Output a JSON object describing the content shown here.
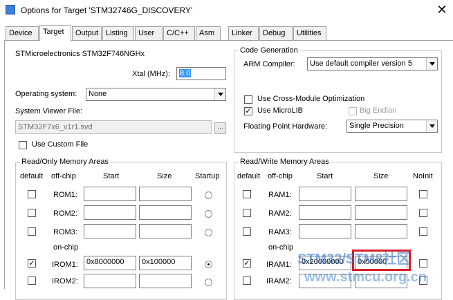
{
  "window": {
    "title": "Options for Target 'STM32746G_DISCOVERY'",
    "close_glyph": "✕"
  },
  "tabs": [
    {
      "label": "Device"
    },
    {
      "label": "Target"
    },
    {
      "label": "Output"
    },
    {
      "label": "Listing"
    },
    {
      "label": "User"
    },
    {
      "label": "C/C++"
    },
    {
      "label": "Asm"
    },
    {
      "label": "Linker"
    },
    {
      "label": "Debug"
    },
    {
      "label": "Utilities"
    }
  ],
  "target": {
    "device_name": "STMicroelectronics STM32F746NGHx",
    "xtal_label": "Xtal (MHz):",
    "xtal_value": "8.0",
    "os_label": "Operating system:",
    "os_value": "None",
    "svf_label": "System Viewer File:",
    "svf_value": "STM32F7x6_v1r1.svd",
    "browse_label": "...",
    "custom_file_label": "Use Custom File"
  },
  "code_generation": {
    "title": "Code Generation",
    "arm_compiler_label": "ARM Compiler:",
    "arm_compiler_value": "Use default compiler version 5",
    "cross_module_label": "Use Cross-Module Optimization",
    "microlib_label": "Use MicroLIB",
    "big_endian_label": "Big Endian",
    "fph_label": "Floating Point Hardware:",
    "fph_value": "Single Precision",
    "check_glyph": "✓"
  },
  "ro_memory": {
    "title": "Read/Only Memory Areas",
    "headers": {
      "default": "default",
      "offchip": "off-chip",
      "start": "Start",
      "size": "Size",
      "startup": "Startup"
    },
    "onchip_label": "on-chip",
    "rows": [
      {
        "name": "ROM1:",
        "start": "",
        "size": ""
      },
      {
        "name": "ROM2:",
        "start": "",
        "size": ""
      },
      {
        "name": "ROM3:",
        "start": "",
        "size": ""
      },
      {
        "name": "IROM1:",
        "start": "0x8000000",
        "size": "0x100000"
      },
      {
        "name": "IROM2:",
        "start": "",
        "size": ""
      }
    ]
  },
  "rw_memory": {
    "title": "Read/Write Memory Areas",
    "headers": {
      "default": "default",
      "offchip": "off-chip",
      "start": "Start",
      "size": "Size",
      "noinit": "NoInit"
    },
    "onchip_label": "on-chip",
    "rows": [
      {
        "name": "RAM1:",
        "start": "",
        "size": ""
      },
      {
        "name": "RAM2:",
        "start": "",
        "size": ""
      },
      {
        "name": "RAM3:",
        "start": "",
        "size": ""
      },
      {
        "name": "IRAM1:",
        "start": "0x20000000",
        "size": "0x50000"
      },
      {
        "name": "IRAM2:",
        "start": "",
        "size": ""
      }
    ]
  },
  "watermark": {
    "line1": "STM32/STM8社区",
    "line2": "www.stmcu.org.cn"
  }
}
